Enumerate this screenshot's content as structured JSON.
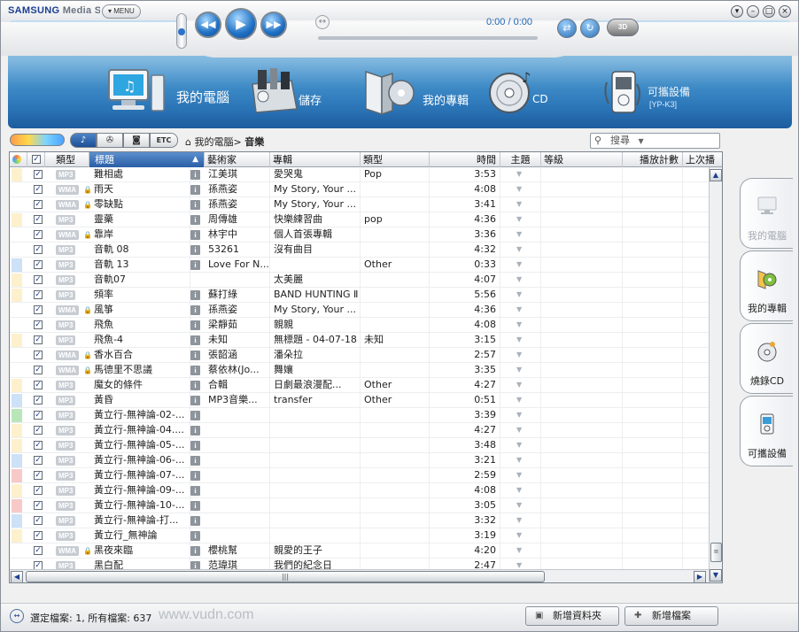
{
  "app": {
    "brand": "SAMSUNG",
    "product": "Media Stu",
    "menu_label": "MENU"
  },
  "player": {
    "time": "0:00 / 0:00",
    "btn_3d": "3D"
  },
  "modes": [
    {
      "label": "我的電腦",
      "sub": ""
    },
    {
      "label": "儲存",
      "sub": ""
    },
    {
      "label": "我的專輯",
      "sub": ""
    },
    {
      "label": "CD",
      "sub": ""
    },
    {
      "label": "可攜設備",
      "sub": "[YP-K3]"
    }
  ],
  "toolbar": {
    "etc_label": "ETC",
    "crumb_root": "我的電腦",
    "crumb_sep": ">",
    "crumb_current": "音樂",
    "search_label": "搜尋"
  },
  "columns": {
    "type": "類型",
    "title": "標題",
    "artist": "藝術家",
    "album": "專輯",
    "genre": "類型",
    "time": "時間",
    "theme": "主題",
    "rating": "等級",
    "playcount": "播放計數",
    "lastplayed": "上次播"
  },
  "rows": [
    {
      "swatch": "#fdf0cc",
      "fmt": "MP3",
      "lock": false,
      "title": "難相處",
      "info": true,
      "artist": "江美琪",
      "album": "愛哭鬼",
      "genre": "Pop",
      "time": "3:53"
    },
    {
      "swatch": "",
      "fmt": "WMA",
      "lock": true,
      "title": "雨天",
      "info": true,
      "artist": "孫燕姿",
      "album": "My Story, Your ...",
      "genre": "",
      "time": "4:08"
    },
    {
      "swatch": "",
      "fmt": "WMA",
      "lock": true,
      "title": "零缺點",
      "info": true,
      "artist": "孫燕姿",
      "album": "My Story, Your ...",
      "genre": "",
      "time": "3:41"
    },
    {
      "swatch": "#fdf0cc",
      "fmt": "MP3",
      "lock": false,
      "title": "靈藥",
      "info": true,
      "artist": "周傳雄",
      "album": "快樂練習曲",
      "genre": "pop",
      "time": "4:36"
    },
    {
      "swatch": "",
      "fmt": "WMA",
      "lock": true,
      "title": "靠岸",
      "info": true,
      "artist": "林宇中",
      "album": "個人首張專輯",
      "genre": "",
      "time": "3:36"
    },
    {
      "swatch": "",
      "fmt": "MP3",
      "lock": false,
      "title": "音軌 08",
      "info": true,
      "artist": "53261",
      "album": "沒有曲目",
      "genre": "",
      "time": "4:32"
    },
    {
      "swatch": "#cde1f7",
      "fmt": "MP3",
      "lock": false,
      "title": "音軌 13",
      "info": true,
      "artist": "Love For N...",
      "album": "",
      "genre": "Other",
      "time": "0:33"
    },
    {
      "swatch": "#fdf0cc",
      "fmt": "MP3",
      "lock": false,
      "title": "音軌07",
      "info": false,
      "artist": "",
      "album": "太美麗",
      "genre": "",
      "time": "4:07"
    },
    {
      "swatch": "#fdf0cc",
      "fmt": "MP3",
      "lock": false,
      "title": "頻率",
      "info": true,
      "artist": "蘇打綠",
      "album": "BAND HUNTING Ⅱ",
      "genre": "",
      "time": "5:56"
    },
    {
      "swatch": "",
      "fmt": "WMA",
      "lock": true,
      "title": "風箏",
      "info": true,
      "artist": "孫燕姿",
      "album": "My Story, Your ...",
      "genre": "",
      "time": "4:36"
    },
    {
      "swatch": "",
      "fmt": "MP3",
      "lock": false,
      "title": "飛魚",
      "info": true,
      "artist": "梁靜茹",
      "album": "親親",
      "genre": "",
      "time": "4:08"
    },
    {
      "swatch": "#fdf0cc",
      "fmt": "MP3",
      "lock": false,
      "title": "飛魚-4",
      "info": true,
      "artist": "未知",
      "album": "無標題 - 04-07-18",
      "genre": "未知",
      "time": "3:15"
    },
    {
      "swatch": "",
      "fmt": "WMA",
      "lock": true,
      "title": "香水百合",
      "info": true,
      "artist": "張韶涵",
      "album": "潘朵拉",
      "genre": "",
      "time": "2:57"
    },
    {
      "swatch": "",
      "fmt": "WMA",
      "lock": true,
      "title": "馬德里不思議",
      "info": true,
      "artist": "蔡依林(Jo...",
      "album": "舞孃",
      "genre": "",
      "time": "3:35"
    },
    {
      "swatch": "#fdf0cc",
      "fmt": "MP3",
      "lock": false,
      "title": "魔女的條件",
      "info": true,
      "artist": "合輯",
      "album": "日劇最浪漫配...",
      "genre": "Other",
      "time": "4:27"
    },
    {
      "swatch": "#cde1f7",
      "fmt": "MP3",
      "lock": false,
      "title": "黃昏",
      "info": true,
      "artist": "MP3音樂...",
      "album": "transfer",
      "genre": "Other",
      "time": "0:51"
    },
    {
      "swatch": "#b9e6b9",
      "fmt": "MP3",
      "lock": false,
      "title": "黃立行-無神論-02-...",
      "info": true,
      "artist": "",
      "album": "",
      "genre": "",
      "time": "3:39"
    },
    {
      "swatch": "#fdf0cc",
      "fmt": "MP3",
      "lock": false,
      "title": "黃立行-無神論-04....",
      "info": true,
      "artist": "",
      "album": "",
      "genre": "",
      "time": "4:27"
    },
    {
      "swatch": "#fdf0cc",
      "fmt": "MP3",
      "lock": false,
      "title": "黃立行-無神論-05-...",
      "info": true,
      "artist": "",
      "album": "",
      "genre": "",
      "time": "3:48"
    },
    {
      "swatch": "#cde1f7",
      "fmt": "MP3",
      "lock": false,
      "title": "黃立行-無神論-06-...",
      "info": true,
      "artist": "",
      "album": "",
      "genre": "",
      "time": "3:21"
    },
    {
      "swatch": "#f8c9c9",
      "fmt": "MP3",
      "lock": false,
      "title": "黃立行-無神論-07-...",
      "info": true,
      "artist": "",
      "album": "",
      "genre": "",
      "time": "2:59"
    },
    {
      "swatch": "#fdf0cc",
      "fmt": "MP3",
      "lock": false,
      "title": "黃立行-無神論-09-...",
      "info": true,
      "artist": "",
      "album": "",
      "genre": "",
      "time": "4:08"
    },
    {
      "swatch": "#f8c9c9",
      "fmt": "MP3",
      "lock": false,
      "title": "黃立行-無神論-10-...",
      "info": true,
      "artist": "",
      "album": "",
      "genre": "",
      "time": "3:05"
    },
    {
      "swatch": "#cde1f7",
      "fmt": "MP3",
      "lock": false,
      "title": "黃立行-無神論-打...",
      "info": true,
      "artist": "",
      "album": "",
      "genre": "",
      "time": "3:32"
    },
    {
      "swatch": "#fdf0cc",
      "fmt": "MP3",
      "lock": false,
      "title": "黃立行_無神論",
      "info": true,
      "artist": "",
      "album": "",
      "genre": "",
      "time": "3:19"
    },
    {
      "swatch": "",
      "fmt": "WMA",
      "lock": true,
      "title": "黑夜來臨",
      "info": true,
      "artist": "櫻桃幫",
      "album": "親愛的王子",
      "genre": "",
      "time": "4:20"
    },
    {
      "swatch": "",
      "fmt": "MP3",
      "lock": false,
      "title": "黑白配",
      "info": true,
      "artist": "范瑋琪",
      "album": "我們的紀念日",
      "genre": "",
      "time": "2:47"
    }
  ],
  "side_tabs": [
    {
      "label": "我的電腦",
      "disabled": true
    },
    {
      "label": "我的專輯",
      "disabled": false
    },
    {
      "label": "燒錄CD",
      "disabled": false
    },
    {
      "label": "可攜設備",
      "disabled": false
    }
  ],
  "status": {
    "text": "選定檔案: 1, 所有檔案: 637",
    "watermark": "www.vudn.com",
    "new_folder": "新增資料夾",
    "new_file": "新增檔案"
  },
  "colors": {
    "accent": "#1f65b7",
    "banner": "#2c76b8"
  }
}
